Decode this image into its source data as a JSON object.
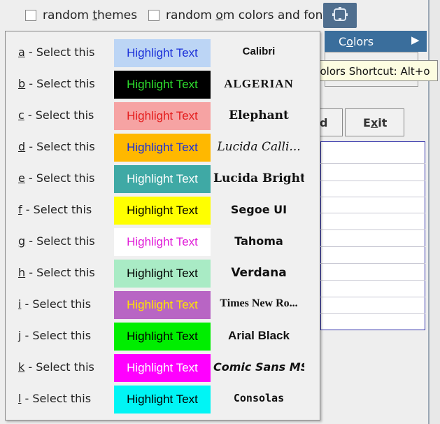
{
  "topbar": {
    "random_themes": {
      "label_pre": "random ",
      "label_key": "t",
      "label_post": "hemes"
    },
    "random_colors": {
      "label_pre": "random ",
      "label_key": "o",
      "label_post": "m colors and fonts"
    },
    "icon": "palette-icon"
  },
  "colors_menu": {
    "label_pre": "C",
    "label_key": "o",
    "label_post": "lors",
    "arrow": "▶"
  },
  "tooltip": "Colors Shortcut: Alt+o",
  "background_buttons": {
    "partial": "d",
    "exit_pre": "E",
    "exit_key": "x",
    "exit_post": "it"
  },
  "colors": {
    "selected_row_bg": "#3a6e9c",
    "tooltip_bg": "#fdfde1"
  },
  "highlight_rows": [
    {
      "key": "a",
      "label": " - Select this",
      "text": "Highlight Text",
      "bg": "#bcd5f5",
      "fg": "#1a2fd8",
      "font": "Calibri"
    },
    {
      "key": "b",
      "label": " - Select this",
      "text": "Highlight Text",
      "bg": "#000000",
      "fg": "#2ee02e",
      "font": "ALGERIAN"
    },
    {
      "key": "c",
      "label": " - Select this",
      "text": "Highlight Text",
      "bg": "#f6a3a3",
      "fg": "#e41c1c",
      "font": "Elephant"
    },
    {
      "key": "d",
      "label": " - Select this",
      "text": "Highlight Text",
      "bg": "#ffb800",
      "fg": "#1a2fd8",
      "font": "Lucida Calli..."
    },
    {
      "key": "e",
      "label": " - Select this",
      "text": "Highlight Text",
      "bg": "#3fa9a5",
      "fg": "#ffffff",
      "font": "Lucida Bright"
    },
    {
      "key": "f",
      "label": " - Select this",
      "text": "Highlight Text",
      "bg": "#ffff00",
      "fg": "#000000",
      "font": "Segoe UI"
    },
    {
      "key": "g",
      "label": " - Select this",
      "text": "Highlight Text",
      "bg": "#ffffff",
      "fg": "#e01cd8",
      "font": "Tahoma"
    },
    {
      "key": "h",
      "label": " - Select this",
      "text": "Highlight Text",
      "bg": "#a9ebc5",
      "fg": "#000000",
      "font": "Verdana"
    },
    {
      "key": "i",
      "label": " - Select this",
      "text": "Highlight Text",
      "bg": "#b865c4",
      "fg": "#ffe600",
      "font": "Times New Ro..."
    },
    {
      "key": "j",
      "label": " - Select this",
      "text": "Highlight Text",
      "bg": "#00ee00",
      "fg": "#000000",
      "font": "Arial Black"
    },
    {
      "key": "k",
      "label": " - Select this",
      "text": "Highlight Text",
      "bg": "#ff00ff",
      "fg": "#ffffff",
      "font": "Comic Sans MS"
    },
    {
      "key": "l",
      "label": " - Select this",
      "text": "Highlight Text",
      "bg": "#00f5f5",
      "fg": "#000000",
      "font": "Consolas"
    }
  ]
}
